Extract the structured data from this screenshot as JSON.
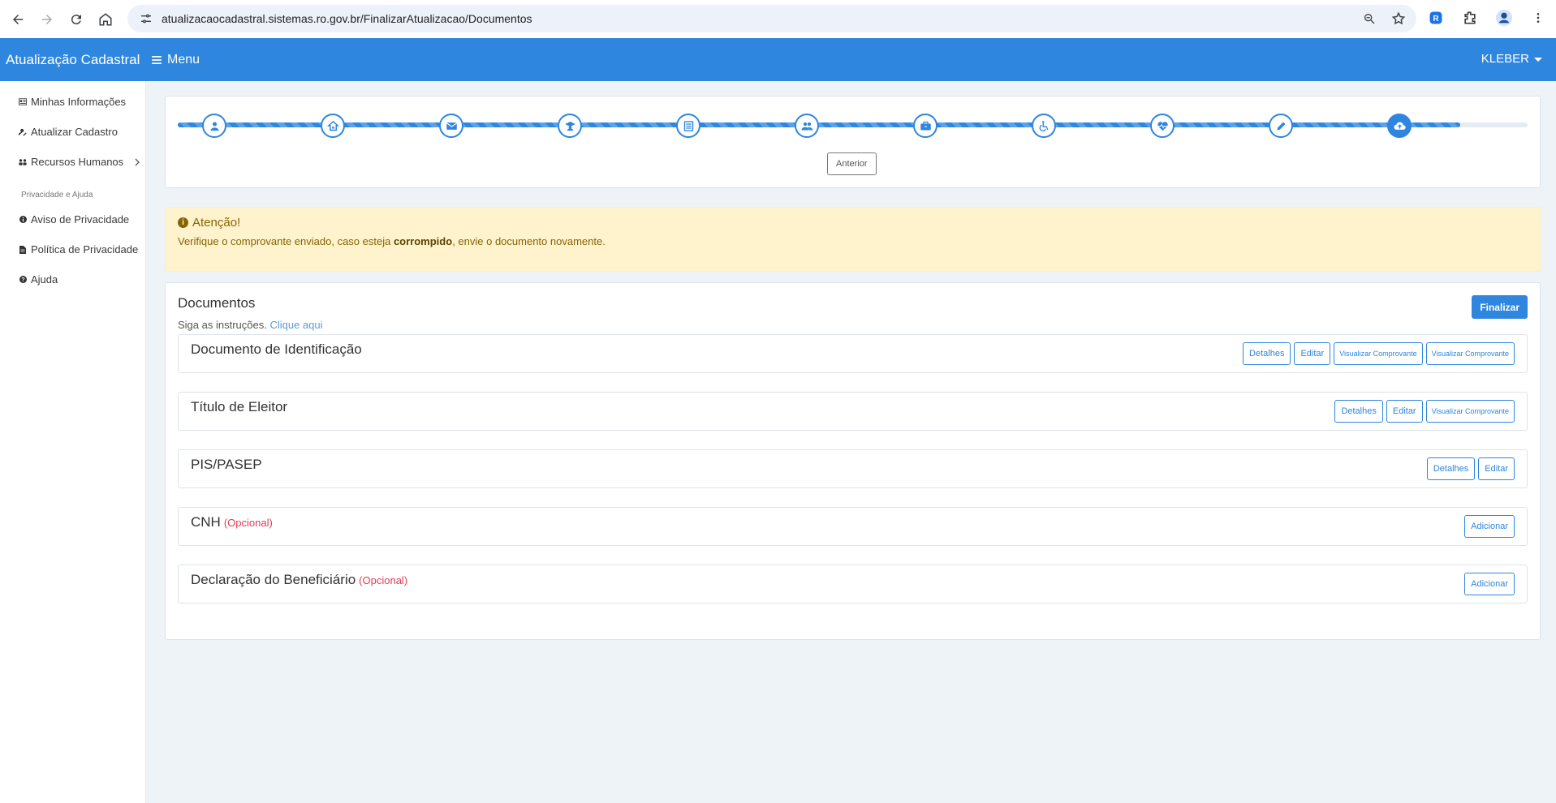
{
  "browser": {
    "url": "atualizacaocadastral.sistemas.ro.gov.br/FinalizarAtualizacao/Documentos"
  },
  "header": {
    "brand": "Atualização Cadastral",
    "menu_label": "Menu",
    "user": "KLEBER"
  },
  "sidebar": {
    "items": [
      {
        "label": "Minhas Informações",
        "icon": "id-card-icon"
      },
      {
        "label": "Atualizar Cadastro",
        "icon": "user-edit-icon"
      },
      {
        "label": "Recursos Humanos",
        "icon": "users-icon"
      }
    ],
    "section_title": "Privacidade e Ajuda",
    "help_items": [
      {
        "label": "Aviso de Privacidade",
        "icon": "info-icon"
      },
      {
        "label": "Política de Privacidade",
        "icon": "file-icon"
      },
      {
        "label": "Ajuda",
        "icon": "question-icon"
      }
    ]
  },
  "stepper": {
    "steps": [
      "user-icon",
      "home-icon",
      "envelope-icon",
      "graduation-icon",
      "newspaper-icon",
      "users-icon",
      "briefcase-icon",
      "wheelchair-icon",
      "heartbeat-icon",
      "pen-icon",
      "cloud-upload-icon"
    ],
    "active_step": 11,
    "progress_percent": 95,
    "prev_label": "Anterior"
  },
  "alert": {
    "title": "Atenção!",
    "text_before": "Verifique o comprovante enviado, caso esteja ",
    "text_bold": "corrompido",
    "text_after": ", envie o documento novamente."
  },
  "documents": {
    "title": "Documentos",
    "finalize_label": "Finalizar",
    "instructions": "Siga as instruções.",
    "instructions_link": "Clique aqui",
    "rows": [
      {
        "name": "Documento de Identificação",
        "optional": "",
        "buttons": [
          "Detalhes",
          "Editar",
          "Visualizar Comprovante",
          "Visualizar Comprovante"
        ]
      },
      {
        "name": "Título de Eleitor",
        "optional": "",
        "buttons": [
          "Detalhes",
          "Editar",
          "Visualizar Comprovante"
        ]
      },
      {
        "name": "PIS/PASEP",
        "optional": "",
        "buttons": [
          "Detalhes",
          "Editar"
        ]
      },
      {
        "name": "CNH",
        "optional": "(Opcional)",
        "buttons": [
          "Adicionar"
        ]
      },
      {
        "name": "Declaração do Beneficiário",
        "optional": "(Opcional)",
        "buttons": [
          "Adicionar"
        ]
      }
    ]
  },
  "colors": {
    "primary": "#2e86de",
    "alert_bg": "#fff3cd",
    "optional": "#e33a55"
  }
}
